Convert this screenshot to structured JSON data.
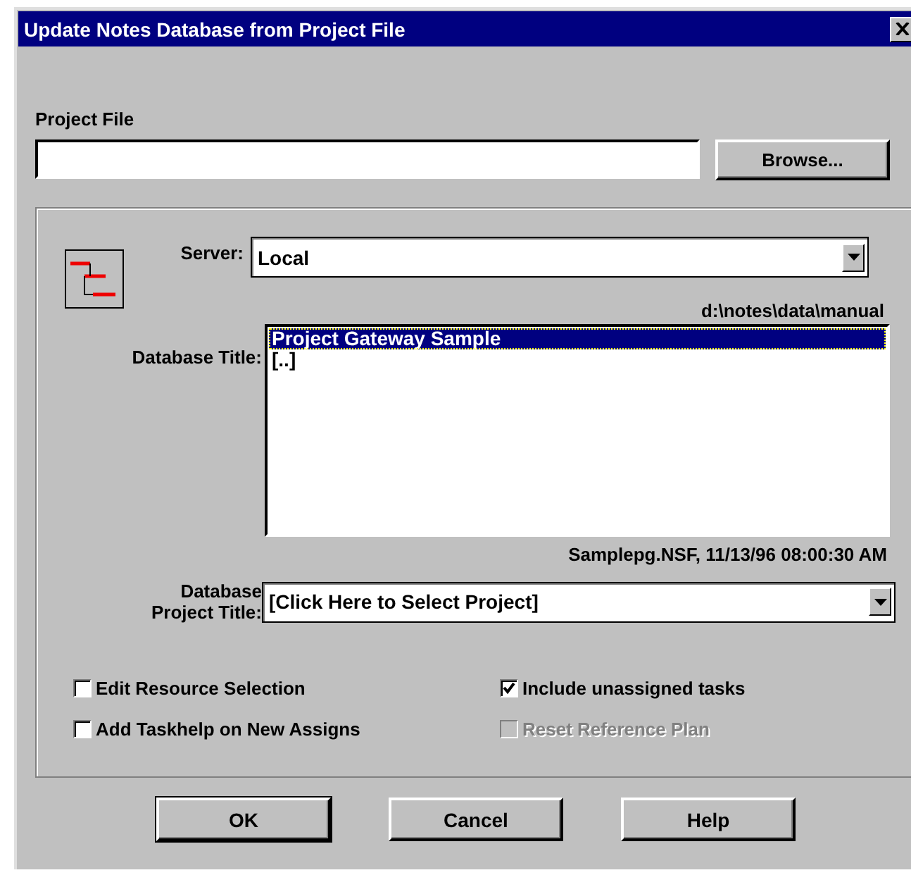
{
  "window": {
    "title": "Update Notes Database from Project File"
  },
  "project_file": {
    "label": "Project File",
    "browse": "Browse..."
  },
  "server": {
    "label": "Server:",
    "value": "Local",
    "path": "d:\\notes\\data\\manual"
  },
  "database_title": {
    "label": "Database Title:",
    "items": [
      {
        "text": "Project Gateway Sample",
        "selected": true
      },
      {
        "text": "[..]",
        "selected": false
      }
    ],
    "info": "Samplepg.NSF, 11/13/96 08:00:30 AM"
  },
  "project_title": {
    "label_lines": [
      "Database",
      "Project Title:"
    ],
    "value": "[Click Here to Select Project]"
  },
  "options": [
    {
      "label": "Edit Resource Selection",
      "checked": false,
      "disabled": false
    },
    {
      "label": "Include unassigned tasks",
      "checked": true,
      "disabled": false
    },
    {
      "label": "Add Taskhelp on New Assigns",
      "checked": false,
      "disabled": false
    },
    {
      "label": "Reset Reference Plan",
      "checked": false,
      "disabled": true
    }
  ],
  "buttons": [
    {
      "label": "OK",
      "default": true
    },
    {
      "label": "Cancel",
      "default": false
    },
    {
      "label": "Help",
      "default": false
    }
  ]
}
